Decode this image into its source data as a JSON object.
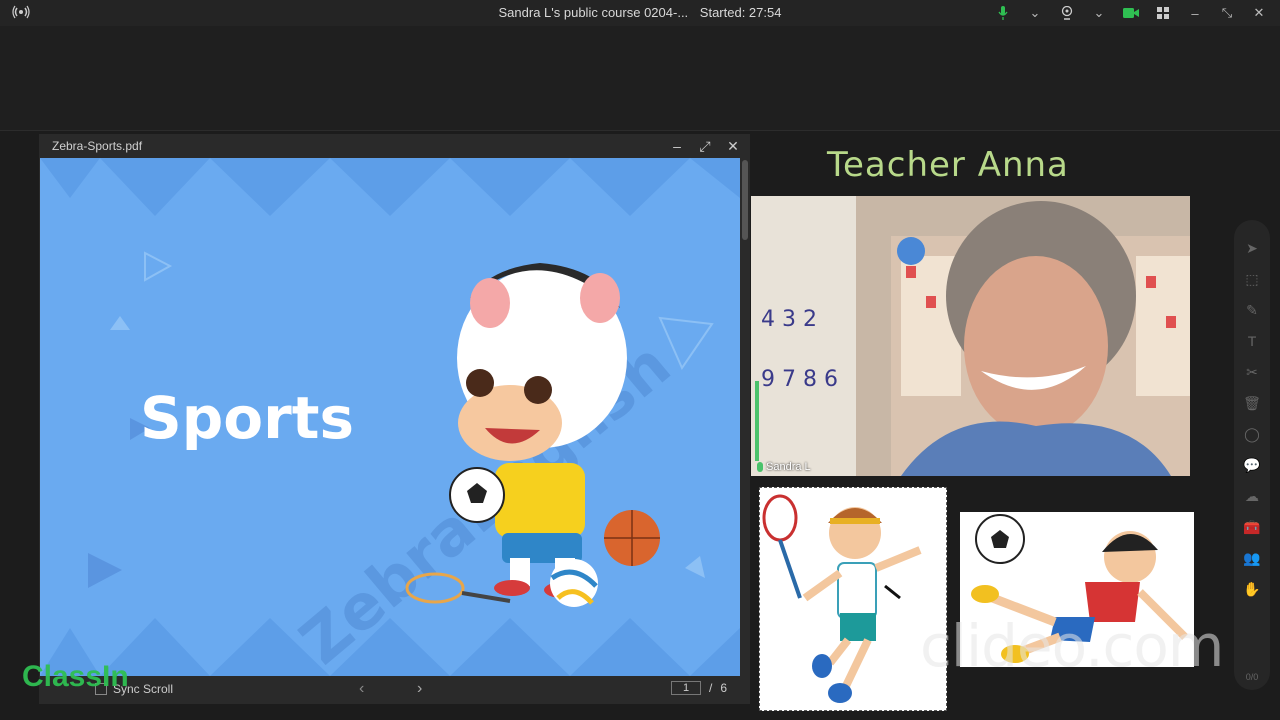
{
  "topbar": {
    "course_title": "Sandra L's public course 0204-...",
    "started_label": "Started: 27:54",
    "icons": [
      "broadcast-icon",
      "microphone-icon",
      "chevron-down-icon",
      "webcam-icon",
      "chevron-down-icon",
      "camera-icon",
      "grid-layout-icon",
      "minimize-icon",
      "restore-icon",
      "close-icon"
    ]
  },
  "pdf_viewer": {
    "filename": "Zebra-Sports.pdf",
    "slide_title": "Sports",
    "slide_watermark": "ZebraEnglish",
    "sync_scroll_label": "Sync Scroll",
    "current_page": "1",
    "page_separator": "/",
    "total_pages": "6"
  },
  "teacher": {
    "label": "Teacher  Anna",
    "video_name": "Sandra L"
  },
  "branding": {
    "app_logo": "ClassIn",
    "watermark": "clideo.com"
  },
  "toolbar": {
    "tools": [
      "pointer-icon",
      "selection-icon",
      "pen-icon",
      "text-icon",
      "scissors-icon",
      "trash-icon",
      "shape-icon",
      "chat-icon",
      "cloud-icon",
      "toolbox-icon",
      "users-icon",
      "raise-hand-icon"
    ],
    "count": "0/0"
  },
  "colors": {
    "slide_bg": "#6aaaf0",
    "teacher_label": "#b8d98a",
    "camera_on": "#2fbf52",
    "mic_on": "#4ac26b"
  }
}
